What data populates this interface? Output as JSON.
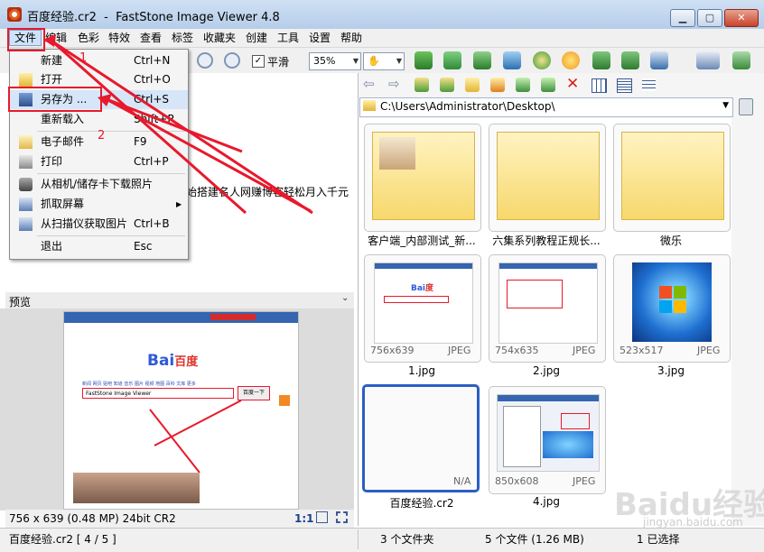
{
  "window": {
    "title": "百度经验.cr2  -  FastStone Image Viewer 4.8",
    "controls": [
      "minimize",
      "maximize",
      "close"
    ]
  },
  "menubar": [
    "文件",
    "编辑",
    "色彩",
    "特效",
    "查看",
    "标签",
    "收藏夹",
    "创建",
    "工具",
    "设置",
    "帮助"
  ],
  "toolbar": {
    "smooth_label": "平滑",
    "smooth_checked": true,
    "zoom_value": "35%"
  },
  "file_menu": [
    {
      "label": "新建",
      "shortcut": "Ctrl+N",
      "icon": "new-icon"
    },
    {
      "label": "打开",
      "shortcut": "Ctrl+O",
      "icon": "open-folder-icon"
    },
    {
      "label": "另存为 ...",
      "shortcut": "Ctrl+S",
      "icon": "save-disk-icon"
    },
    {
      "label": "重新载入",
      "shortcut": "Shift+R",
      "icon": ""
    },
    {
      "label": "电子邮件",
      "shortcut": "F9",
      "icon": "email-icon"
    },
    {
      "label": "打印",
      "shortcut": "Ctrl+P",
      "icon": "printer-icon"
    },
    {
      "label": "从相机/储存卡下载照片",
      "shortcut": "",
      "icon": "camera-icon"
    },
    {
      "label": "抓取屏幕",
      "shortcut": "",
      "icon": "capture-icon",
      "submenu": true
    },
    {
      "label": "从扫描仪获取图片",
      "shortcut": "Ctrl+B",
      "icon": "scanner-icon"
    },
    {
      "label": "退出",
      "shortcut": "Esc",
      "icon": ""
    }
  ],
  "background_text": "始搭建名人网赚博客轻松月入千元",
  "preview": {
    "title": "预览",
    "info": "756 x 639 (0.48 MP)  24bit  CR2",
    "ratio_label": "1:1",
    "site_logo_blue": "Bai",
    "site_logo_red": "百度",
    "search_text": "FastStone Image Viewer",
    "search_button": "百度一下",
    "nav_links": "新闻 网页 贴吧 知道 音乐 图片 视频 地图 百科 文库 更多"
  },
  "path": "C:\\Users\\Administrator\\Desktop\\",
  "thumbnails": [
    {
      "caption": "客户端_内部测试_新...",
      "type": "folder",
      "dims": "",
      "format": ""
    },
    {
      "caption": "六集系列教程正规长...",
      "type": "folder",
      "dims": "",
      "format": ""
    },
    {
      "caption": "微乐",
      "type": "folder",
      "dims": "",
      "format": ""
    },
    {
      "caption": "1.jpg",
      "type": "image",
      "dims": "756x639",
      "format": "JPEG"
    },
    {
      "caption": "2.jpg",
      "type": "image",
      "dims": "754x635",
      "format": "JPEG"
    },
    {
      "caption": "3.jpg",
      "type": "image",
      "dims": "523x517",
      "format": "JPEG"
    },
    {
      "caption": "百度经验.cr2",
      "type": "raw",
      "dims": "",
      "format": "N/A",
      "selected": true
    },
    {
      "caption": "4.jpg",
      "type": "image",
      "dims": "850x608",
      "format": "JPEG"
    }
  ],
  "statusbar": {
    "file": "百度经验.cr2 [ 4 / 5 ]",
    "folders": "3 个文件夹",
    "files": "5 个文件 (1.26 MB)",
    "selected": "1 已选择"
  },
  "annotations": {
    "num1": "1",
    "num2": "2"
  },
  "watermark": {
    "main": "Baidu经验",
    "sub": "jingyan.baidu.com"
  },
  "colors": {
    "accent_red": "#e8192c",
    "selection_blue": "#2b5ec5",
    "titlebar": "#c2d6ee"
  }
}
